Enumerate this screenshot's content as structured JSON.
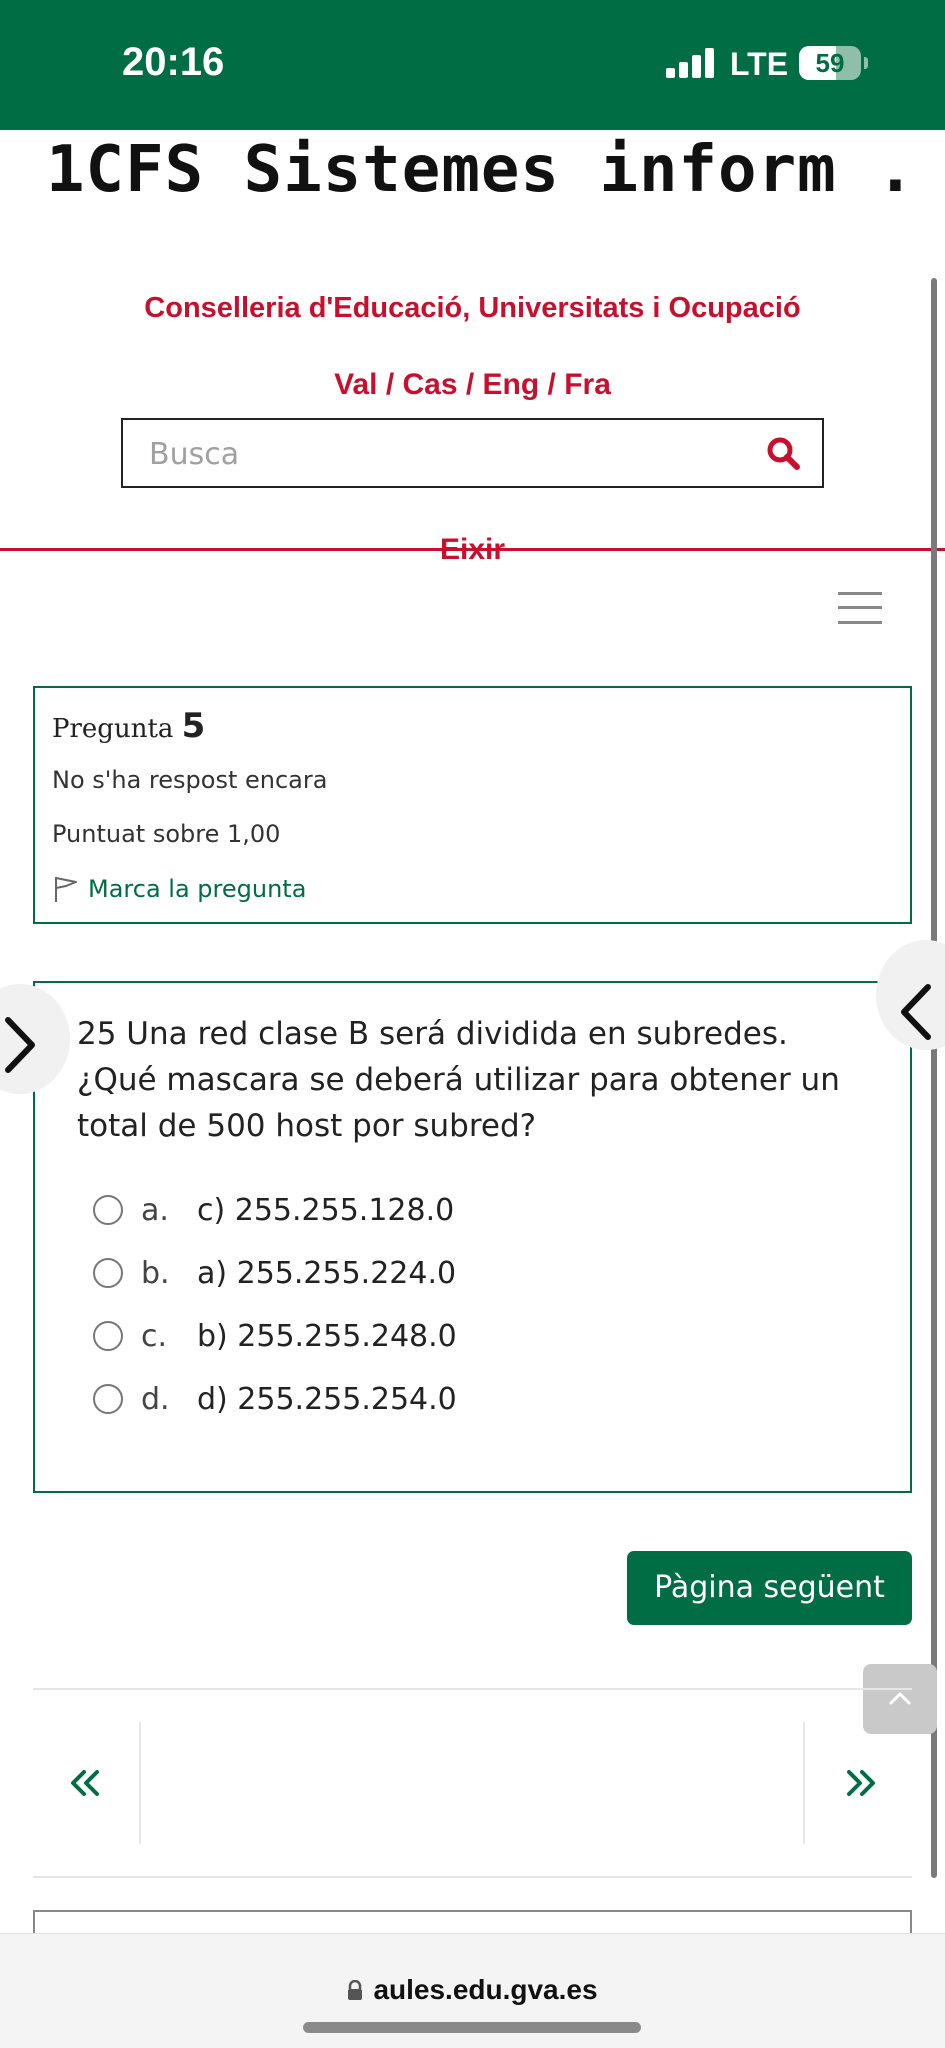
{
  "status_bar": {
    "time": "20:16",
    "network": "LTE",
    "battery": "59",
    "battery_percent": 59
  },
  "header": {
    "site_title": "1CFS Sistemes inform ...",
    "organization": "Conselleria d'Educació, Universitats i Ocupació",
    "languages": "Val / Cas / Eng / Fra",
    "search_placeholder": "Busca",
    "logout_label": "Eixir"
  },
  "question_info": {
    "label": "Pregunta",
    "number": "5",
    "status": "No s'ha respost encara",
    "score": "Puntuat sobre 1,00",
    "flag_label": "Marca la pregunta"
  },
  "question": {
    "text": "25 Una red clase B será dividida en subredes. ¿Qué mascara se deberá utilizar para obtener un total de 500 host por subred?",
    "options": [
      {
        "letter": "a.",
        "text": "c) 255.255.128.0"
      },
      {
        "letter": "b.",
        "text": "a) 255.255.224.0"
      },
      {
        "letter": "c.",
        "text": "b) 255.255.248.0"
      },
      {
        "letter": "d.",
        "text": "d) 255.255.254.0"
      }
    ]
  },
  "actions": {
    "next_page": "Pàgina següent"
  },
  "browser": {
    "url": "aules.edu.gva.es"
  },
  "colors": {
    "primary": "#006d45",
    "accent_red": "#c8102e"
  }
}
